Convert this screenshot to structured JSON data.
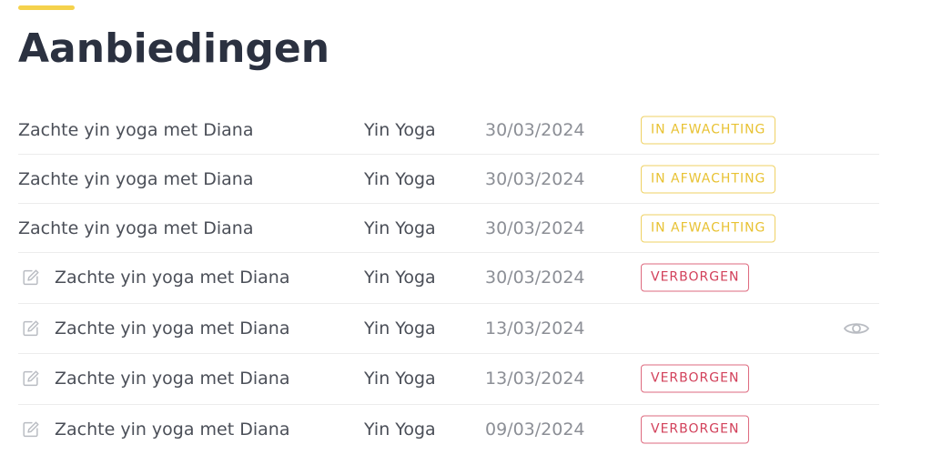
{
  "page": {
    "title": "Aanbiedingen",
    "accent_color": "#f5d24c"
  },
  "offers": [
    {
      "title": "Zachte yin yoga met Diana",
      "category": "Yin Yoga",
      "date": "30/03/2024",
      "status": "IN AFWACHTING",
      "status_type": "pending",
      "editable": false,
      "icon": ""
    },
    {
      "title": "Zachte yin yoga met Diana",
      "category": "Yin Yoga",
      "date": "30/03/2024",
      "status": "IN AFWACHTING",
      "status_type": "pending",
      "editable": false,
      "icon": ""
    },
    {
      "title": "Zachte yin yoga met Diana",
      "category": "Yin Yoga",
      "date": "30/03/2024",
      "status": "IN AFWACHTING",
      "status_type": "pending",
      "editable": false,
      "icon": ""
    },
    {
      "title": "Zachte yin yoga met Diana",
      "category": "Yin Yoga",
      "date": "30/03/2024",
      "status": "VERBORGEN",
      "status_type": "hidden",
      "editable": true,
      "icon": "edit-icon"
    },
    {
      "title": "Zachte yin yoga met Diana",
      "category": "Yin Yoga",
      "date": "13/03/2024",
      "status": "",
      "status_type": "visible",
      "editable": true,
      "icon": "edit-icon",
      "action_icon": "eye-icon"
    },
    {
      "title": "Zachte yin yoga met Diana",
      "category": "Yin Yoga",
      "date": "13/03/2024",
      "status": "VERBORGEN",
      "status_type": "hidden",
      "editable": true,
      "icon": "edit-icon"
    },
    {
      "title": "Zachte yin yoga met Diana",
      "category": "Yin Yoga",
      "date": "09/03/2024",
      "status": "VERBORGEN",
      "status_type": "hidden",
      "editable": true,
      "icon": "edit-icon"
    }
  ],
  "colors": {
    "pending": "#e8c233",
    "hidden": "#d2405a",
    "title": "#2b3140",
    "text": "#4b4f58",
    "date": "#8c8f96",
    "icon": "#b9bcc2"
  }
}
